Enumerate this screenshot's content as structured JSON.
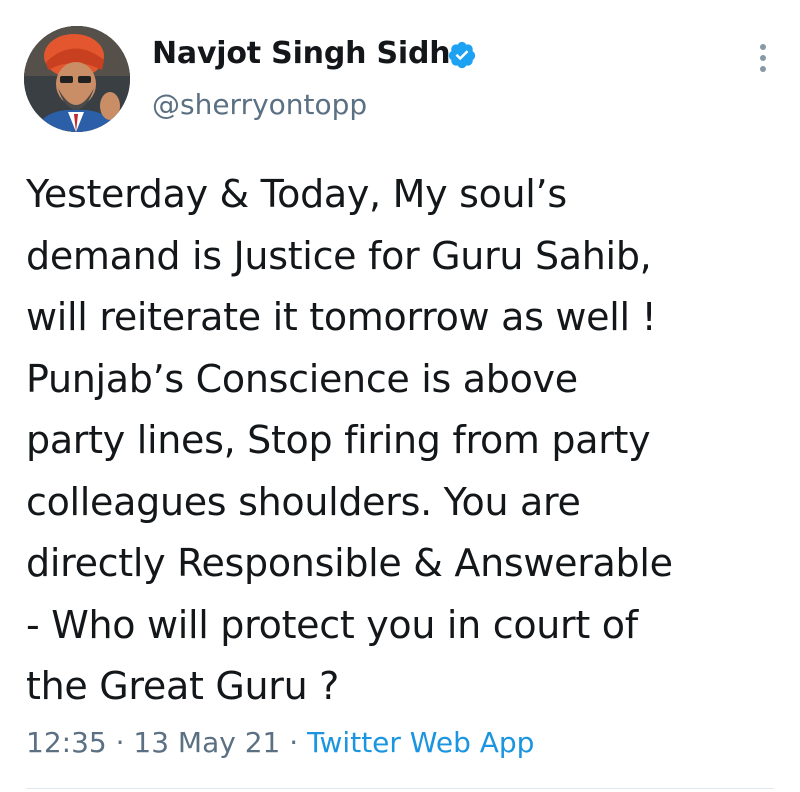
{
  "author": {
    "display_name": "Navjot Singh Sidhu",
    "handle": "@sherryontopp",
    "verified": true,
    "avatar_icon": "profile-photo"
  },
  "tweet": {
    "lines": [
      "Yesterday & Today, My soul’s",
      "demand is Justice for Guru Sahib,",
      "will reiterate it tomorrow as well !",
      "Punjab’s Conscience is above",
      "party lines, Stop firing from party",
      "colleagues shoulders. You are",
      "directly Responsible & Answerable",
      "- Who will protect you in court of",
      "the Great Guru ?"
    ]
  },
  "meta": {
    "time": "12:35",
    "separator": " · ",
    "date": "13 May 21",
    "source": "Twitter Web App"
  },
  "colors": {
    "accent": "#1b95e0",
    "verified_badge": "#1da1f2",
    "secondary_text": "#5b7083",
    "primary_text": "#14171a"
  }
}
